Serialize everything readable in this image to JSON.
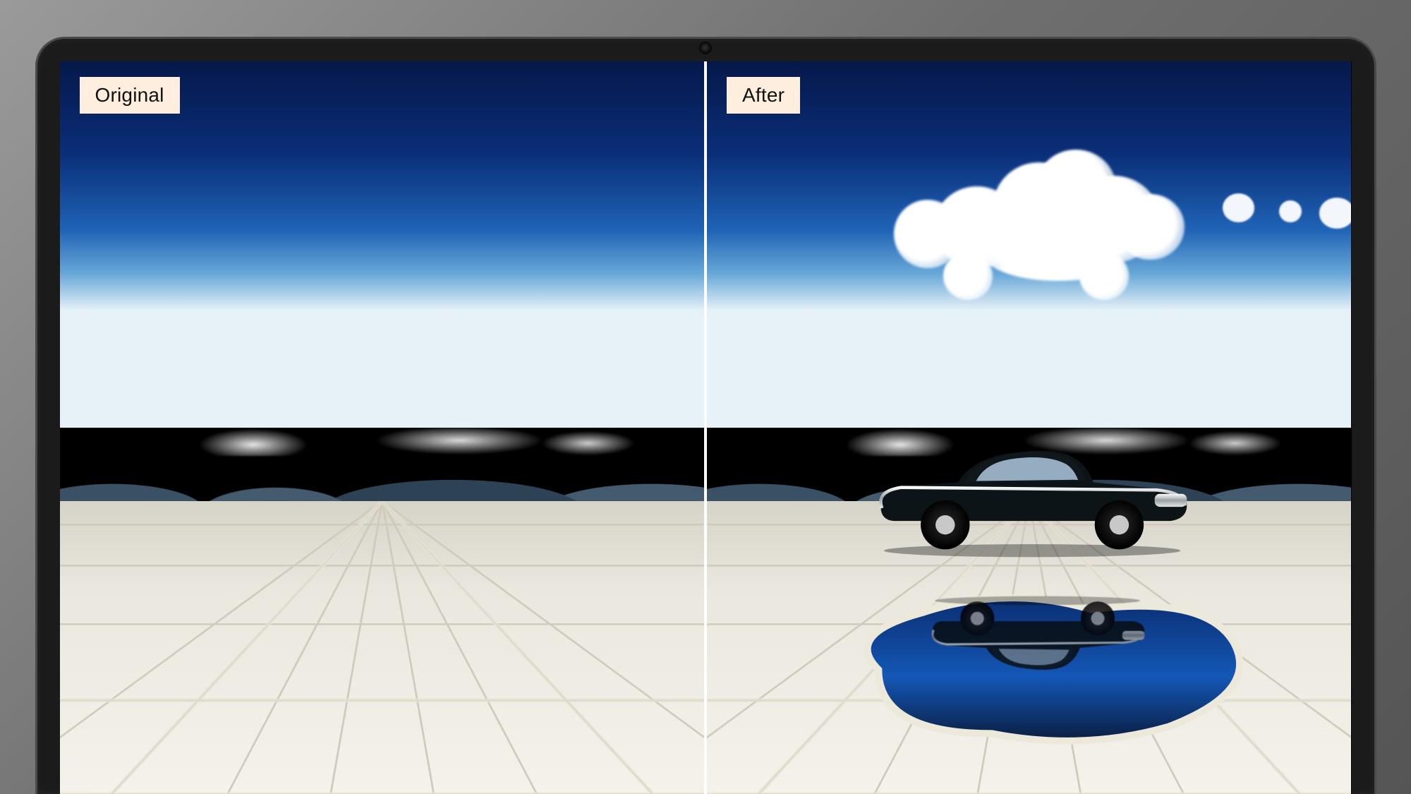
{
  "labels": {
    "left": "Original",
    "right": "After"
  },
  "colors": {
    "tag_bg": "#fdeedd",
    "tag_text": "#111111",
    "bezel": "#1b1b1b",
    "divider": "#ffffff",
    "sky_top": "#06184a",
    "sky_bottom": "#e6f1f8",
    "salt": "#f0efe6",
    "water": "#114d9e",
    "car_body": "#0c1418"
  },
  "scene": {
    "location_type": "salt flat desert with distant mountains",
    "left_contents": "empty cracked salt flat under deep blue sky",
    "right_added_elements": [
      "car-shaped cloud",
      "vintage black car",
      "reflective water puddle"
    ]
  }
}
